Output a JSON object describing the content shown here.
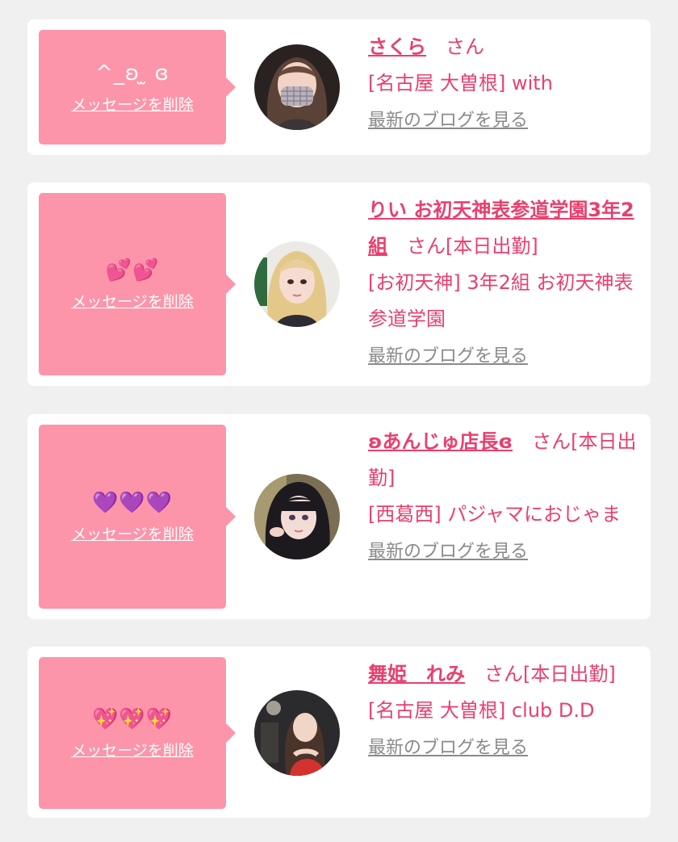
{
  "colors": {
    "page_bg": "#f0f0f0",
    "card_bg": "#ffffff",
    "bubble": "#fc95a9",
    "accent": "#e8406e",
    "blog_link": "#8a8a8a"
  },
  "messages": [
    {
      "message": "^_ʚ ̫ ɞ",
      "delete_label": "メッセージを削除",
      "avatar_icon": "girl-photo-avatar-icon",
      "name": "さくら",
      "honorific": "さん",
      "status": "",
      "shop": "[名古屋 大曽根] with",
      "blog_label": "最新のブログを見る"
    },
    {
      "message": "💕💕",
      "delete_label": "メッセージを削除",
      "avatar_icon": "girl-photo-avatar-icon",
      "name": "りい お初天神表参道学園3年2組",
      "honorific": "さん",
      "status": "[本日出勤]",
      "shop": "[お初天神] 3年2組 お初天神表参道学園",
      "blog_label": "最新のブログを見る"
    },
    {
      "message": "💜💜💜",
      "delete_label": "メッセージを削除",
      "avatar_icon": "girl-photo-avatar-icon",
      "name": "ʚあんじゅ店長ɞ",
      "honorific": "さん",
      "status": "[本日出勤]",
      "shop": "[西葛西] パジャマにおじゃま",
      "blog_label": "最新のブログを見る"
    },
    {
      "message": "💖💖💖",
      "delete_label": "メッセージを削除",
      "avatar_icon": "girl-photo-avatar-icon",
      "name": "舞姫　れみ",
      "honorific": "さん",
      "status": "[本日出勤]",
      "shop": "[名古屋 大曽根] club D.D",
      "blog_label": "最新のブログを見る"
    }
  ]
}
